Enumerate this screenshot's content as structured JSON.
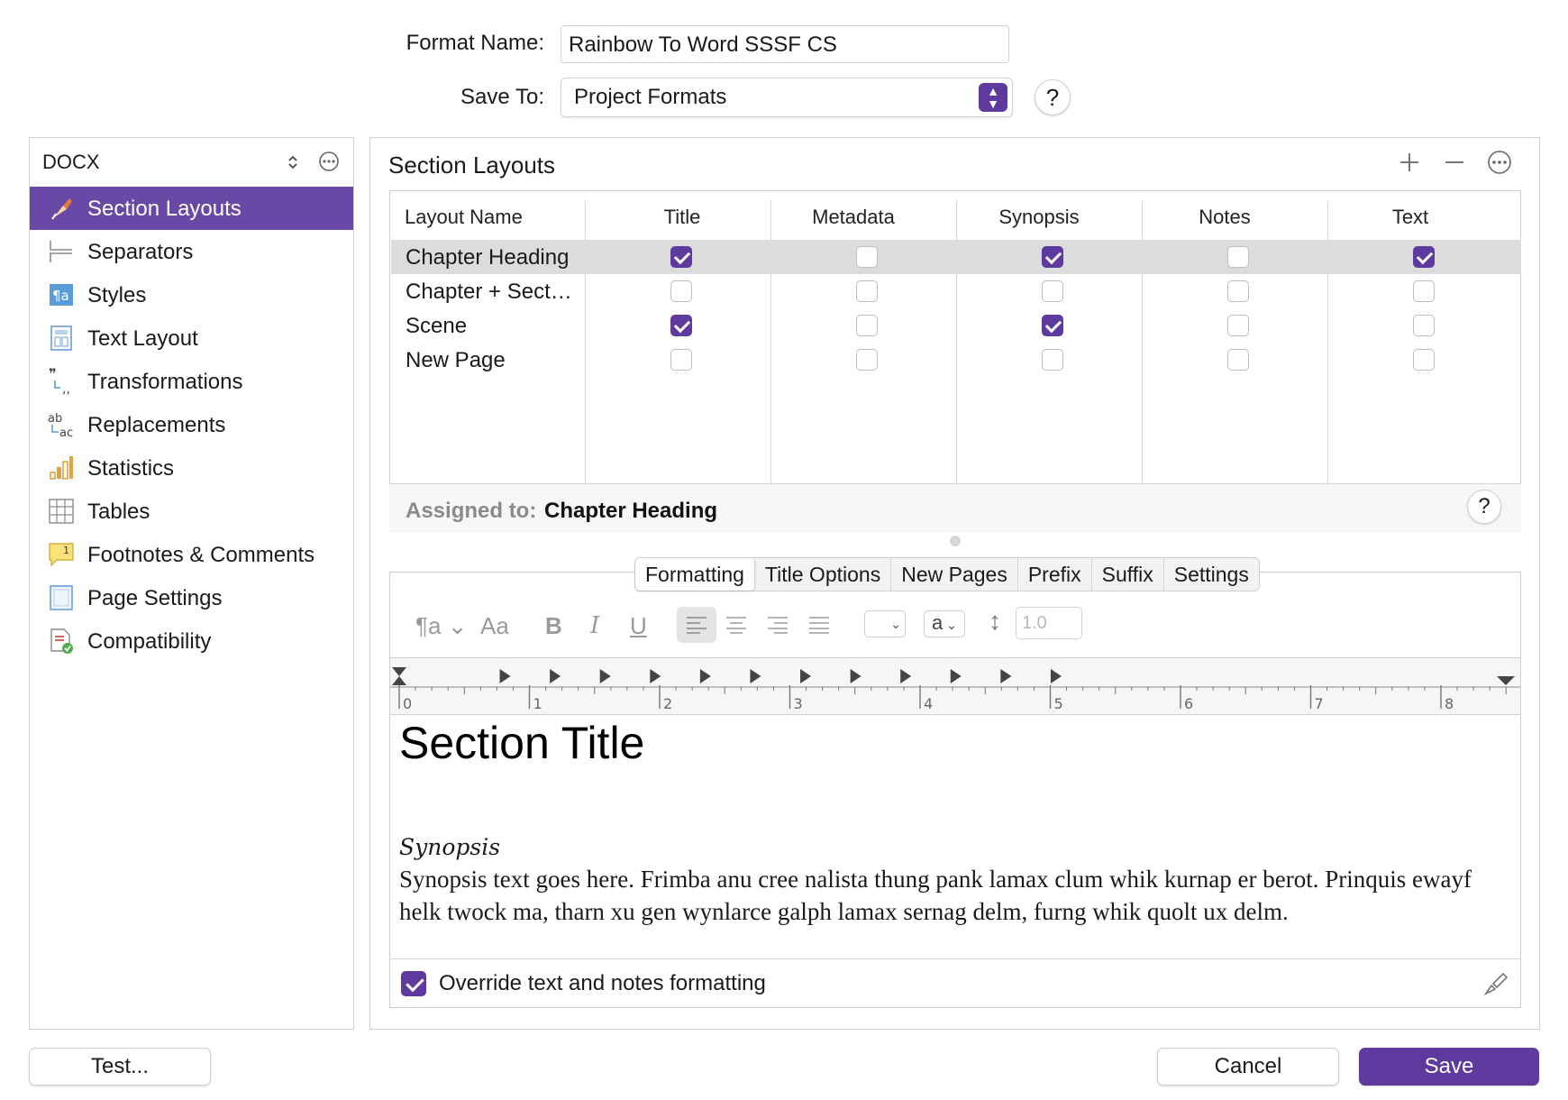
{
  "header": {
    "format_name_label": "Format Name:",
    "format_name_value": "Rainbow To Word SSSF CS",
    "save_to_label": "Save To:",
    "save_to_value": "Project Formats",
    "help_label": "?"
  },
  "sidebar": {
    "format": "DOCX",
    "items": [
      {
        "label": "Section Layouts",
        "icon": "section-layouts-icon",
        "selected": true
      },
      {
        "label": "Separators",
        "icon": "separators-icon"
      },
      {
        "label": "Styles",
        "icon": "styles-icon"
      },
      {
        "label": "Text Layout",
        "icon": "text-layout-icon"
      },
      {
        "label": "Transformations",
        "icon": "transformations-icon"
      },
      {
        "label": "Replacements",
        "icon": "replacements-icon"
      },
      {
        "label": "Statistics",
        "icon": "statistics-icon"
      },
      {
        "label": "Tables",
        "icon": "tables-icon"
      },
      {
        "label": "Footnotes & Comments",
        "icon": "footnotes-icon"
      },
      {
        "label": "Page Settings",
        "icon": "page-settings-icon"
      },
      {
        "label": "Compatibility",
        "icon": "compatibility-icon"
      }
    ]
  },
  "section_layouts": {
    "title": "Section Layouts",
    "columns": [
      "Layout Name",
      "Title",
      "Metadata",
      "Synopsis",
      "Notes",
      "Text"
    ],
    "rows": [
      {
        "name": "Chapter Heading",
        "checks": [
          true,
          false,
          true,
          false,
          true
        ],
        "selected": true
      },
      {
        "name": "Chapter + Sect…",
        "checks": [
          false,
          false,
          false,
          false,
          false
        ]
      },
      {
        "name": "Scene",
        "checks": [
          true,
          false,
          true,
          false,
          false
        ]
      },
      {
        "name": "New Page",
        "checks": [
          false,
          false,
          false,
          false,
          false
        ]
      }
    ],
    "assigned_label": "Assigned to:",
    "assigned_value": "Chapter Heading"
  },
  "tabs": [
    "Formatting",
    "Title Options",
    "New Pages",
    "Prefix",
    "Suffix",
    "Settings"
  ],
  "active_tab": "Formatting",
  "formatting": {
    "font_size_label": "Aa",
    "case_value": "a",
    "line_spacing": "1.0",
    "ruler_numbers": [
      "0",
      "1",
      "2",
      "3",
      "4",
      "5",
      "6",
      "7",
      "8"
    ]
  },
  "preview": {
    "title": "Section Title",
    "synopsis_label": "Synopsis",
    "synopsis_text": "Synopsis text goes here. Frimba anu cree nalista thung pank lamax clum whik kurnap er berot. Prinquis ewayf helk twock ma, tharn xu gen wynlarce galph lamax sernag delm, furng whik quolt ux delm."
  },
  "override_label": "Override text and notes formatting",
  "override_checked": true,
  "buttons": {
    "test": "Test...",
    "cancel": "Cancel",
    "save": "Save"
  },
  "colors": {
    "accent": "#5e3a9e",
    "selection": "#6a48a6",
    "row_selection": "#dcdcdc"
  }
}
